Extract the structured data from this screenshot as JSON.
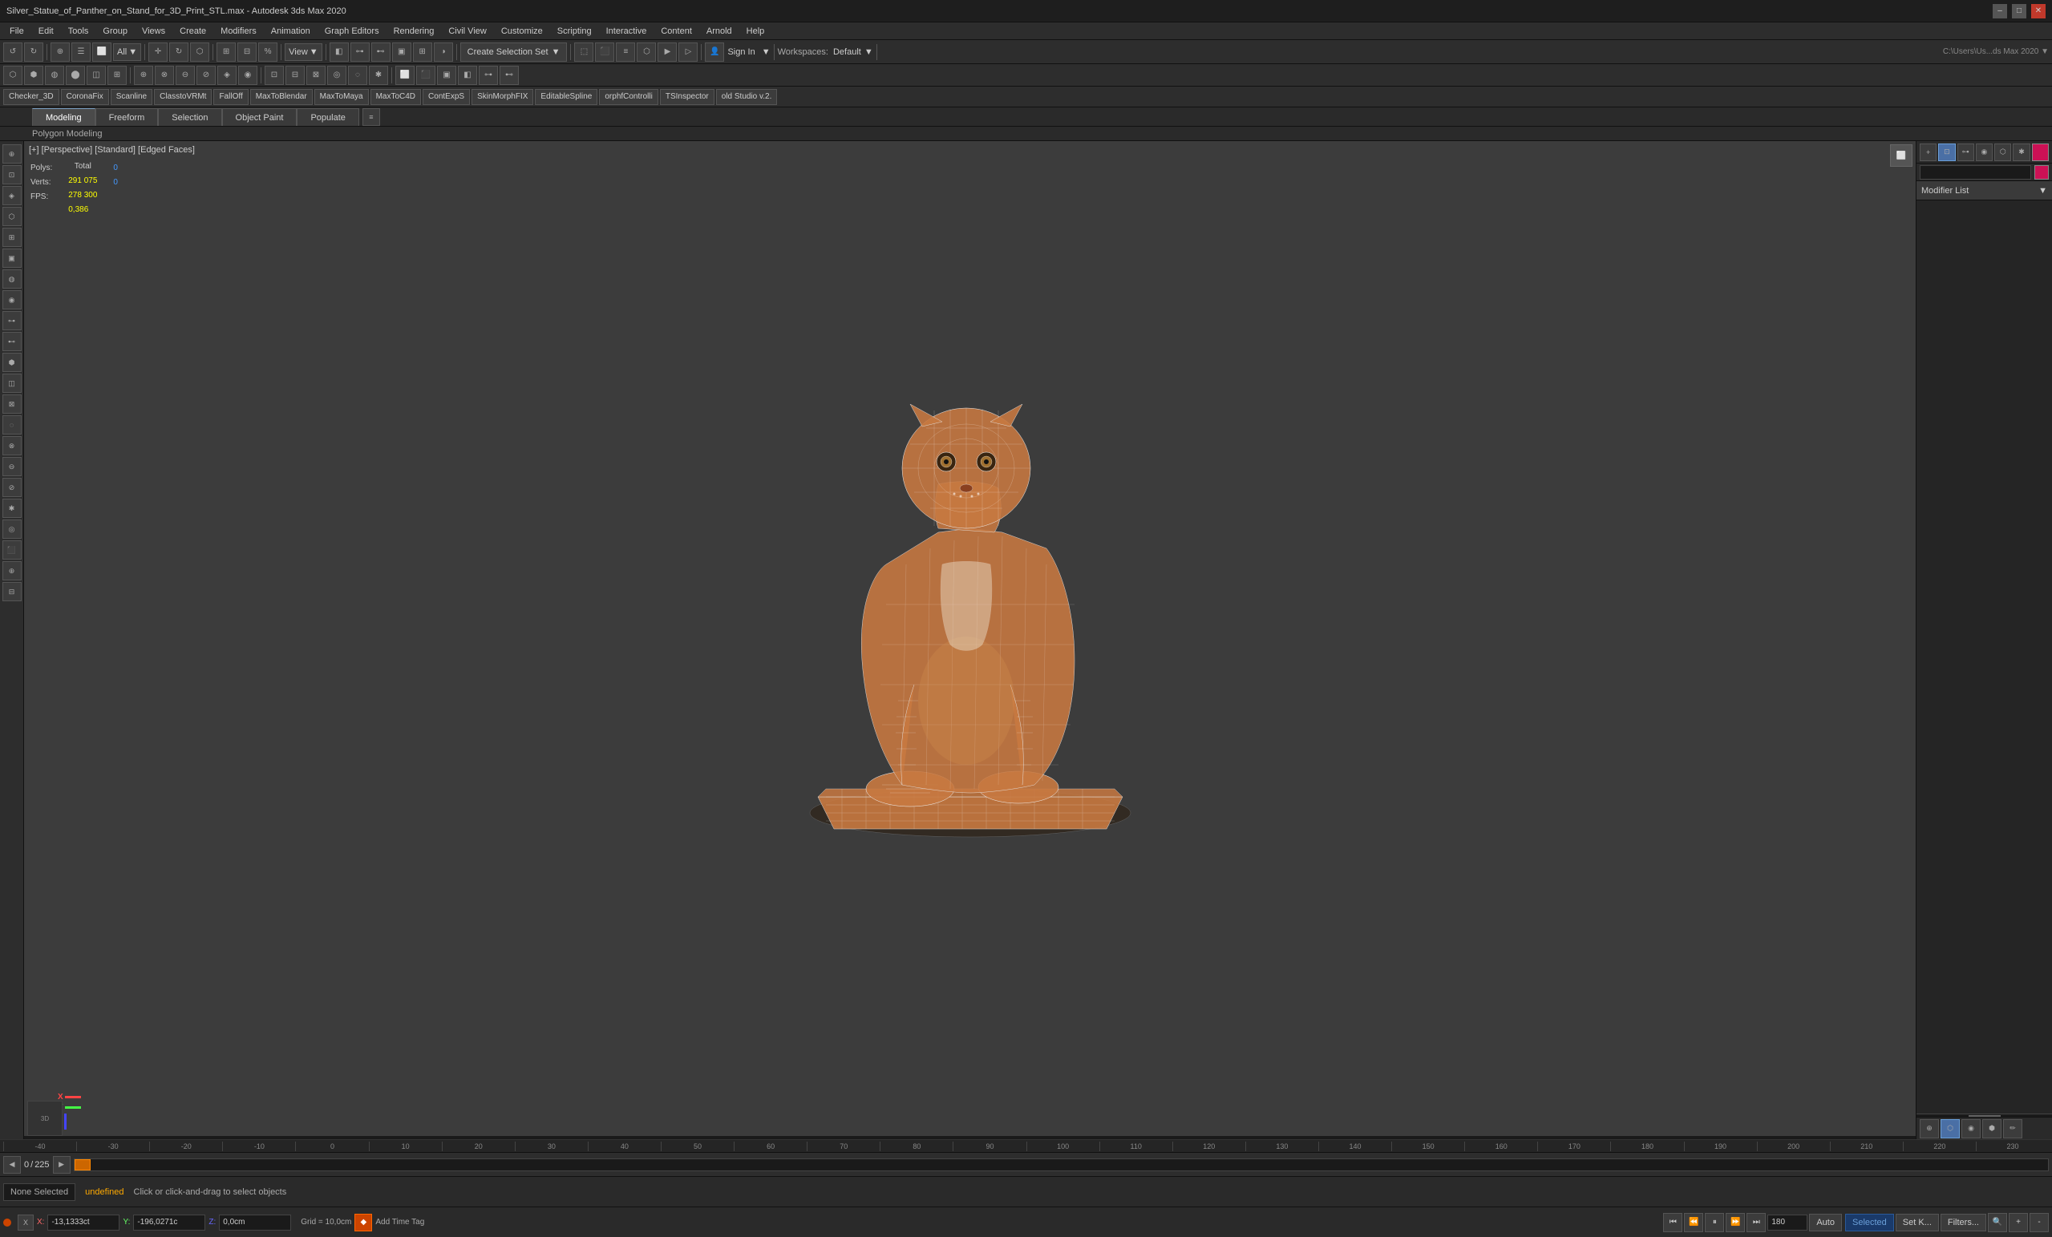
{
  "titlebar": {
    "title": "Silver_Statue_of_Panther_on_Stand_for_3D_Print_STL.max - Autodesk 3ds Max 2020",
    "min_label": "–",
    "max_label": "□",
    "close_label": "✕"
  },
  "menubar": {
    "items": [
      "File",
      "Edit",
      "Tools",
      "Group",
      "Views",
      "Create",
      "Modifiers",
      "Animation",
      "Graph Editors",
      "Rendering",
      "Civil View",
      "Customize",
      "Scripting",
      "Interactive",
      "Content",
      "Arnold",
      "Help"
    ]
  },
  "toolbar": {
    "view_dropdown": "View",
    "all_dropdown": "All",
    "create_selection_label": "Create Selection Set",
    "create_selection_arrow": "▼",
    "sign_in_label": "Sign In",
    "workspaces_label": "Workspaces:",
    "workspaces_value": "Default",
    "path_label": "C:\\Users\\Us...ds Max 2020 ▼"
  },
  "modeling_tabs": {
    "tabs": [
      "Modeling",
      "Freeform",
      "Selection",
      "Object Paint",
      "Populate"
    ]
  },
  "polygon_label": "Polygon Modeling",
  "viewport": {
    "header_label": "[+] [Perspective] [Standard] [Edged Faces]",
    "stats": {
      "polys_label": "Polys:",
      "polys_total": "291 075",
      "polys_selected": "0",
      "verts_label": "Verts:",
      "verts_total": "278 300",
      "verts_selected": "0",
      "fps_label": "FPS:",
      "fps_value": "0,386",
      "column_total": "Total"
    }
  },
  "right_panel": {
    "modifier_list_label": "Modifier List",
    "modifier_list_arrow": "▼",
    "tabs": [
      "hierarchy",
      "motion",
      "display",
      "utilities"
    ]
  },
  "timeline": {
    "frame_current": "0",
    "frame_total": "225",
    "frame_label": "0 / 225"
  },
  "status_bar": {
    "none_selected": "None Selected",
    "instruction": "Click or click-and-drag to select objects"
  },
  "coordinates": {
    "x_label": "X:",
    "x_value": "-13,1333ct",
    "y_label": "Y:",
    "y_value": "-196,0271c",
    "z_label": "Z:",
    "z_value": "0,0cm",
    "grid_label": "Grid = 10,0cm"
  },
  "playback": {
    "auto_label": "Auto",
    "selected_label": "Selected",
    "set_key_label": "Set K...",
    "filters_label": "Filters..."
  },
  "ruler_marks": [
    "-40",
    "-30",
    "-20",
    "-10",
    "0",
    "10",
    "20",
    "30",
    "40",
    "50",
    "60",
    "70",
    "80",
    "90",
    "100",
    "110",
    "120",
    "130",
    "140",
    "150",
    "160",
    "170",
    "180",
    "190",
    "200",
    "210",
    "220",
    "230"
  ],
  "undefined_label": "undefined",
  "plugins": [
    "Checker_3D",
    "CoronaFix",
    "Scanline",
    "ClasstoVRMt",
    "FallOff",
    "MaxToBlendar",
    "MaxToMaya",
    "MaxToC4D",
    "ContExpS",
    "SkinMorphFIX",
    "EditableSpline",
    "orphfControlli",
    "TSInspector",
    "old Studio v.2."
  ]
}
